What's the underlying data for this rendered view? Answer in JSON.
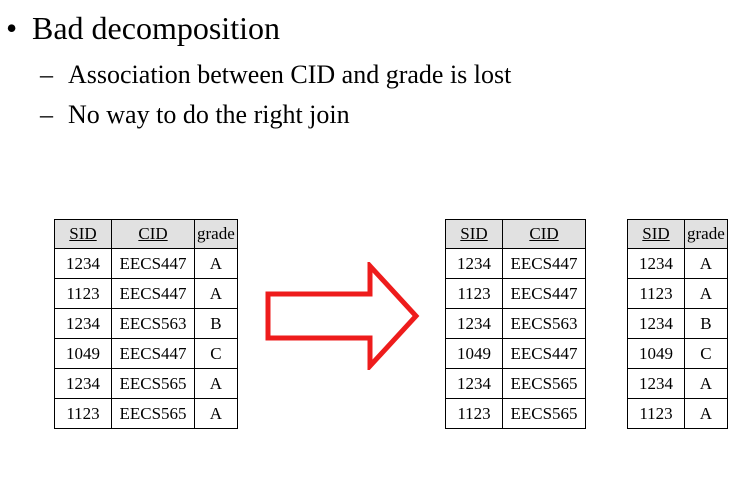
{
  "bullets": {
    "main": "Bad decomposition",
    "subs": [
      "Association between CID and grade is lost",
      "No way to do the right join"
    ]
  },
  "table_left": {
    "headers": [
      "SID",
      "CID",
      "grade"
    ],
    "rows": [
      [
        "1234",
        "EECS447",
        "A"
      ],
      [
        "1123",
        "EECS447",
        "A"
      ],
      [
        "1234",
        "EECS563",
        "B"
      ],
      [
        "1049",
        "EECS447",
        "C"
      ],
      [
        "1234",
        "EECS565",
        "A"
      ],
      [
        "1123",
        "EECS565",
        "A"
      ]
    ]
  },
  "table_mid": {
    "headers": [
      "SID",
      "CID"
    ],
    "rows": [
      [
        "1234",
        "EECS447"
      ],
      [
        "1123",
        "EECS447"
      ],
      [
        "1234",
        "EECS563"
      ],
      [
        "1049",
        "EECS447"
      ],
      [
        "1234",
        "EECS565"
      ],
      [
        "1123",
        "EECS565"
      ]
    ]
  },
  "table_right": {
    "headers": [
      "SID",
      "grade"
    ],
    "rows": [
      [
        "1234",
        "A"
      ],
      [
        "1123",
        "A"
      ],
      [
        "1234",
        "B"
      ],
      [
        "1049",
        "C"
      ],
      [
        "1234",
        "A"
      ],
      [
        "1123",
        "A"
      ]
    ]
  },
  "colors": {
    "arrow_stroke": "#ee1c1c",
    "header_fill": "#e1e1e1"
  },
  "icons": {
    "decomposition_arrow": "right-arrow-outline-icon"
  }
}
